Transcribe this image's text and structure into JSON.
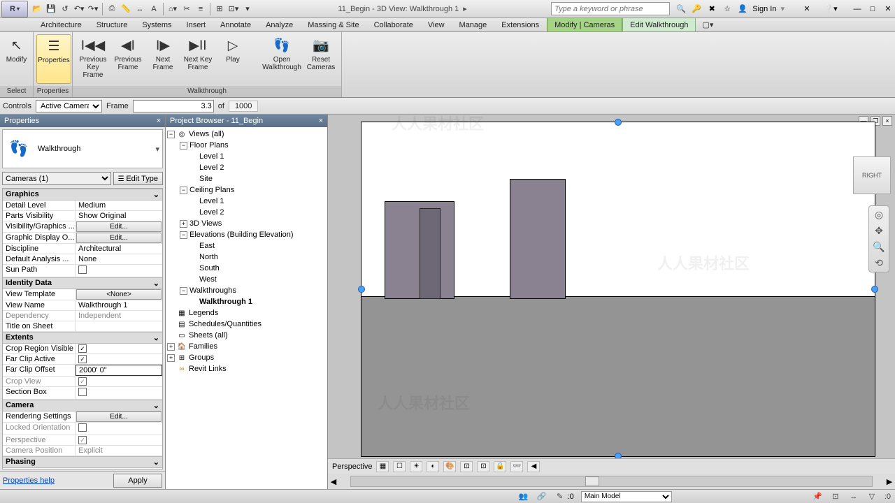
{
  "title": "11_Begin - 3D View: Walkthrough 1",
  "search_placeholder": "Type a keyword or phrase",
  "sign_in": "Sign In",
  "tabs": [
    "Architecture",
    "Structure",
    "Systems",
    "Insert",
    "Annotate",
    "Analyze",
    "Massing & Site",
    "Collaborate",
    "View",
    "Manage",
    "Extensions",
    "Modify | Cameras",
    "Edit Walkthrough"
  ],
  "ribbon": {
    "select": {
      "modify": "Modify",
      "caption": "Select"
    },
    "props": {
      "properties": "Properties",
      "caption": "Properties"
    },
    "walk": {
      "prev_key": "Previous Key Frame",
      "prev_frame": "Previous Frame",
      "next_frame": "Next Frame",
      "next_key": "Next Key Frame",
      "play": "Play",
      "open": "Open Walkthrough",
      "reset": "Reset Cameras",
      "caption": "Walkthrough"
    }
  },
  "optbar": {
    "controls": "Controls",
    "control_mode": "Active Camera",
    "frame_label": "Frame",
    "frame_value": "3.3",
    "of": "of",
    "total": "1000"
  },
  "properties": {
    "title": "Properties",
    "type": "Walkthrough",
    "instance": "Cameras (1)",
    "edit_type": "Edit Type",
    "sections": {
      "graphics": "Graphics",
      "identity": "Identity Data",
      "extents": "Extents",
      "camera": "Camera",
      "phasing": "Phasing"
    },
    "rows": {
      "detail_level": {
        "k": "Detail Level",
        "v": "Medium"
      },
      "parts": {
        "k": "Parts Visibility",
        "v": "Show Original"
      },
      "vis": {
        "k": "Visibility/Graphics ...",
        "v": "Edit..."
      },
      "gdo": {
        "k": "Graphic Display O...",
        "v": "Edit..."
      },
      "discipline": {
        "k": "Discipline",
        "v": "Architectural"
      },
      "analysis": {
        "k": "Default Analysis ...",
        "v": "None"
      },
      "sun": {
        "k": "Sun Path",
        "v": false
      },
      "template": {
        "k": "View Template",
        "v": "<None>"
      },
      "view_name": {
        "k": "View Name",
        "v": "Walkthrough 1"
      },
      "dependency": {
        "k": "Dependency",
        "v": "Independent"
      },
      "title_sheet": {
        "k": "Title on Sheet",
        "v": ""
      },
      "crop_vis": {
        "k": "Crop Region Visible",
        "v": true
      },
      "far_clip": {
        "k": "Far Clip Active",
        "v": true
      },
      "far_off": {
        "k": "Far Clip Offset",
        "v": "2000'  0\""
      },
      "crop_view": {
        "k": "Crop View",
        "v": true
      },
      "section_box": {
        "k": "Section Box",
        "v": false
      },
      "render": {
        "k": "Rendering Settings",
        "v": "Edit..."
      },
      "locked": {
        "k": "Locked Orientation",
        "v": false
      },
      "perspective": {
        "k": "Perspective",
        "v": true
      },
      "cam_pos": {
        "k": "Camera Position",
        "v": "Explicit"
      }
    },
    "help": "Properties help",
    "apply": "Apply"
  },
  "browser": {
    "title": "Project Browser - 11_Begin",
    "views": "Views (all)",
    "floor_plans": "Floor Plans",
    "fp": [
      "Level 1",
      "Level 2",
      "Site"
    ],
    "ceiling_plans": "Ceiling Plans",
    "cp": [
      "Level 1",
      "Level 2"
    ],
    "views3d": "3D Views",
    "elevations": "Elevations (Building Elevation)",
    "el": [
      "East",
      "North",
      "South",
      "West"
    ],
    "walkthroughs": "Walkthroughs",
    "walkthrough1": "Walkthrough 1",
    "legends": "Legends",
    "schedules": "Schedules/Quantities",
    "sheets": "Sheets (all)",
    "families": "Families",
    "groups": "Groups",
    "links": "Revit Links"
  },
  "view_status": {
    "scale": "Perspective"
  },
  "viewcube": {
    "right": "RIGHT"
  },
  "statusbar": {
    "zero": ":0",
    "workset": "Main Model"
  }
}
